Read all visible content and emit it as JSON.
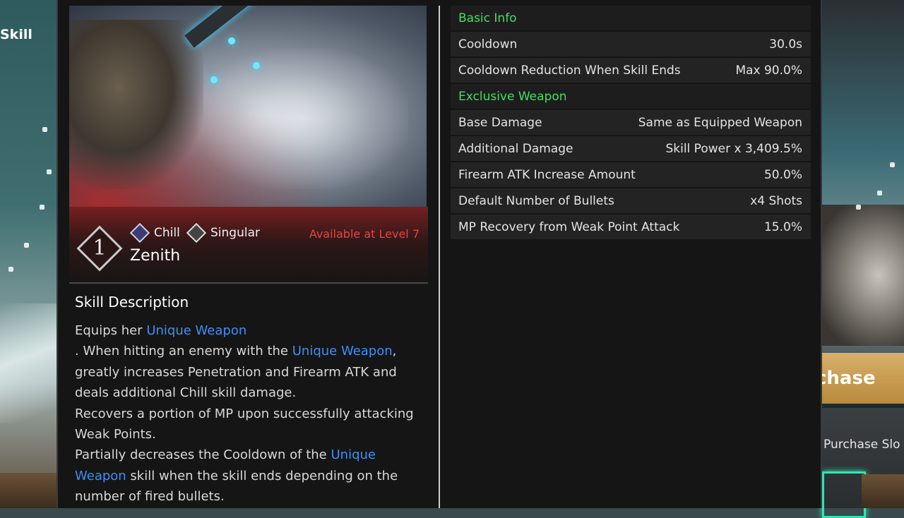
{
  "background": {
    "left_label": "Skill",
    "right_button_label": "chase",
    "right_slot_label": "Purchase Slo"
  },
  "skill": {
    "rank": "1",
    "attributes": [
      {
        "label": "Chill",
        "icon": "chill-attribute-icon"
      },
      {
        "label": "Singular",
        "icon": "singular-attribute-icon"
      }
    ],
    "name": "Zenith",
    "availability": "Available at Level 7"
  },
  "description": {
    "title": "Skill Description",
    "segments": {
      "s1": "Equips her ",
      "k1": "Unique Weapon",
      "s2": ". When hitting an enemy with the ",
      "k2": "Unique Weapon",
      "s3": ", greatly increases Penetration and Firearm ATK and deals additional Chill skill damage.",
      "s4": "Recovers a portion of MP upon successfully attacking Weak Points.",
      "s5": "Partially decreases the Cooldown of the ",
      "k3": "Unique Weapon",
      "s6": " skill when the skill ends depending on the number of fired bullets."
    }
  },
  "stats": {
    "sections": [
      {
        "title": "Basic Info",
        "rows": [
          {
            "label": "Cooldown",
            "value": "30.0s"
          },
          {
            "label": "Cooldown Reduction When Skill Ends",
            "value": "Max 90.0%"
          }
        ]
      },
      {
        "title": "Exclusive Weapon",
        "rows": [
          {
            "label": "Base Damage",
            "value": "Same as Equipped Weapon"
          },
          {
            "label": "Additional Damage",
            "value": "Skill Power x 3,409.5%"
          },
          {
            "label": "Firearm ATK Increase Amount",
            "value": "50.0%"
          },
          {
            "label": "Default Number of Bullets",
            "value": "x4 Shots"
          },
          {
            "label": "MP Recovery from Weak Point Attack",
            "value": "15.0%"
          }
        ]
      }
    ]
  },
  "colors": {
    "section_green": "#3fe05e",
    "keyword_blue": "#3f8ff5",
    "availability_red": "#e04848"
  }
}
